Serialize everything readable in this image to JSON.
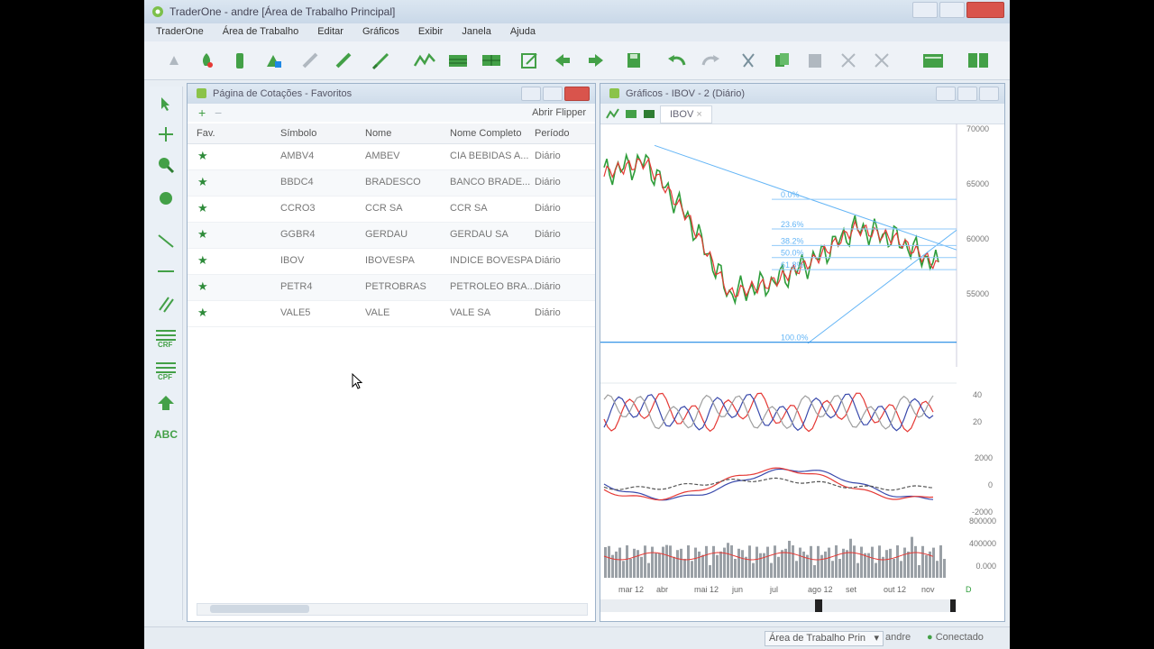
{
  "window": {
    "title": "TraderOne - andre [Área de Trabalho Principal]"
  },
  "menu": [
    "TraderOne",
    "Área de Trabalho",
    "Editar",
    "Gráficos",
    "Exibir",
    "Janela",
    "Ajuda"
  ],
  "quotes_panel": {
    "title": "Página de Cotações - Favoritos",
    "abrir_label": "Abrir Flipper",
    "columns": [
      "Fav.",
      "Símbolo",
      "Nome",
      "Nome Completo",
      "Período"
    ],
    "rows": [
      {
        "symbol": "AMBV4",
        "name": "AMBEV",
        "full": "CIA BEBIDAS A...",
        "period": "Diário"
      },
      {
        "symbol": "BBDC4",
        "name": "BRADESCO",
        "full": "BANCO BRADE...",
        "period": "Diário"
      },
      {
        "symbol": "CCRO3",
        "name": "CCR SA",
        "full": "CCR SA",
        "period": "Diário"
      },
      {
        "symbol": "GGBR4",
        "name": "GERDAU",
        "full": "GERDAU SA",
        "period": "Diário"
      },
      {
        "symbol": "IBOV",
        "name": "IBOVESPA",
        "full": "INDICE BOVESPA",
        "period": "Diário"
      },
      {
        "symbol": "PETR4",
        "name": "PETROBRAS",
        "full": "PETROLEO BRA...",
        "period": "Diário"
      },
      {
        "symbol": "VALE5",
        "name": "VALE",
        "full": "VALE SA",
        "period": "Diário"
      }
    ]
  },
  "chart_panel": {
    "title": "Gráficos - IBOV - 2 (Diário)",
    "tab_label": "IBOV",
    "tab_close": "×",
    "price_ticks": [
      "70000",
      "65000",
      "60000",
      "55000"
    ],
    "fib_levels": [
      "0.0%",
      "23.6%",
      "38.2%",
      "50.0%",
      "61.8%",
      "100.0%"
    ],
    "rsi_ticks": [
      "40",
      "20"
    ],
    "macd_ticks": [
      "2000",
      "0",
      "-2000"
    ],
    "volume_ticks": [
      "800000",
      "400000",
      "0.000"
    ],
    "months": [
      "mar 12",
      "abr",
      "mai 12",
      "jun",
      "jul",
      "ago 12",
      "set",
      "out 12",
      "nov"
    ],
    "period_letter": "D"
  },
  "chart_data": {
    "type": "line",
    "title": "",
    "xlabel": "",
    "ylabel": "",
    "x": [
      "mar 12",
      "abr",
      "mai 12",
      "jun",
      "jul",
      "ago 12",
      "set",
      "out 12",
      "nov"
    ],
    "ylim": [
      50000,
      70000
    ],
    "series": [
      {
        "values": [
          66000,
          67000,
          62000,
          55000,
          56000,
          58000,
          61000,
          60000,
          57500
        ]
      }
    ]
  },
  "status": {
    "workspace": "Área de Trabalho Prin",
    "user": "andre",
    "connection": "Conectado"
  }
}
